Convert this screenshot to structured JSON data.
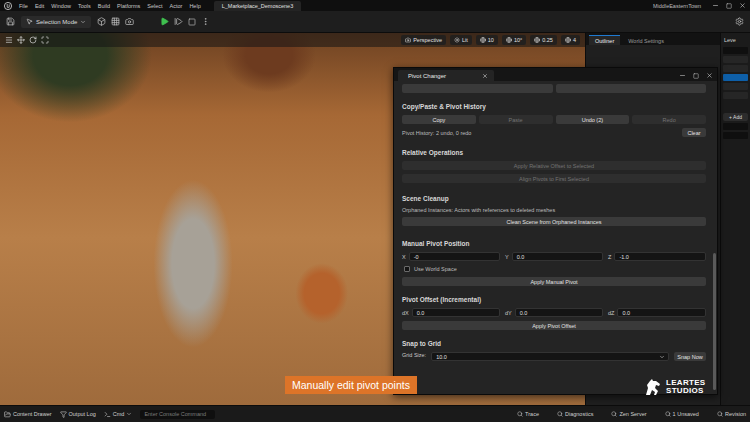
{
  "menu_bar": {
    "items": [
      "File",
      "Edit",
      "Window",
      "Tools",
      "Build",
      "Platforms",
      "Select",
      "Actor",
      "Help"
    ],
    "level_tab": "L_Marketplace_Demoscene3",
    "project": "MiddleEasternTown"
  },
  "toolbar": {
    "mode": "Selection Mode"
  },
  "viewport": {
    "view": "Perspective",
    "view_mode": "Lit",
    "snaps": [
      "10",
      "10°",
      "0.25",
      "4"
    ]
  },
  "outliner": {
    "tabs": [
      {
        "label": "Outliner",
        "selected": true
      },
      {
        "label": "World Settings",
        "selected": false
      }
    ]
  },
  "details": {
    "header": "Leve",
    "add_button": "+ Add",
    "rows": [
      {
        "selected": false
      },
      {
        "selected": false
      },
      {
        "selected": true
      },
      {
        "selected": false
      },
      {
        "selected": false
      }
    ]
  },
  "pivot_window": {
    "title": "Pivot Changer",
    "top_buttons": [
      {
        "disabled": false
      },
      {
        "disabled": false
      }
    ],
    "history": {
      "heading": "Copy/Paste & Pivot History",
      "buttons": [
        {
          "label": "Copy",
          "disabled": false
        },
        {
          "label": "Paste",
          "disabled": true
        },
        {
          "label": "Undo (2)",
          "disabled": false
        },
        {
          "label": "Redo",
          "disabled": true
        }
      ],
      "status": "Pivot History: 2 undo, 0 redo",
      "clear": "Clear"
    },
    "relative": {
      "heading": "Relative Operations",
      "buttons": [
        {
          "label": "Apply Relative Offset to Selected",
          "disabled": true
        },
        {
          "label": "Align Pivots to First Selected",
          "disabled": true
        }
      ]
    },
    "cleanup": {
      "heading": "Scene Cleanup",
      "note": "Orphaned Instances: Actors with references to deleted meshes",
      "button": "Clean Scene from Orphaned Instances"
    },
    "manual": {
      "heading": "Manual Pivot Position",
      "fields": [
        {
          "label": "X",
          "value": "-0"
        },
        {
          "label": "Y",
          "value": "0.0"
        },
        {
          "label": "Z",
          "value": "-1.0"
        }
      ],
      "world_space": {
        "label": "Use World Space",
        "checked": false
      },
      "button": "Apply Manual Pivot"
    },
    "offset": {
      "heading": "Pivot Offset (Incremental)",
      "fields": [
        {
          "label": "dX",
          "value": "0.0"
        },
        {
          "label": "dY",
          "value": "0.0"
        },
        {
          "label": "dZ",
          "value": "0.0"
        }
      ],
      "button": "Apply Pivot Offset"
    },
    "snap": {
      "heading": "Snap to Grid",
      "grid_label": "Grid Size:",
      "grid_value": "10.0",
      "button": "Snap Now"
    }
  },
  "caption": "Manually edit pivot points",
  "logo": {
    "line1": "LEARTES",
    "line2": "STUDIOS"
  },
  "status_bar": {
    "left": [
      "Content Drawer",
      "Output Log"
    ],
    "cmd": "Cmd",
    "console_placeholder": "Enter Console Command",
    "right": [
      "Trace",
      "Diagnostics",
      "Zen Server",
      "1 Unsaved",
      "Revision"
    ]
  }
}
